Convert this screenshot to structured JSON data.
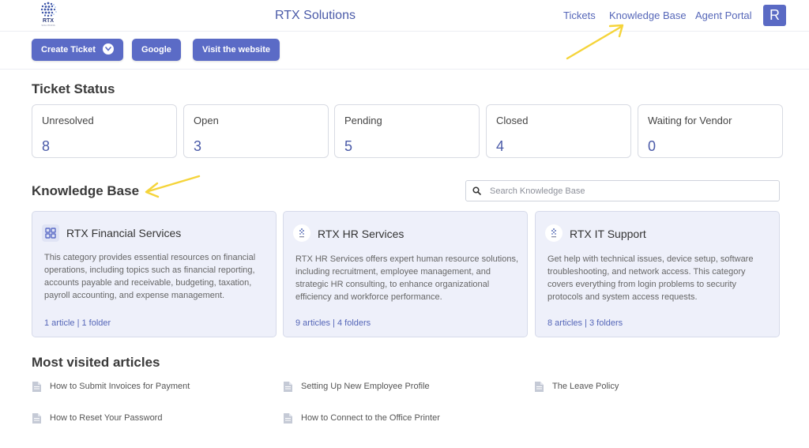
{
  "header": {
    "logo_text": "RTX",
    "logo_subtext": "SOLUTIONS",
    "brand": "RTX Solutions",
    "nav": [
      {
        "label": "Tickets"
      },
      {
        "label": "Knowledge Base"
      },
      {
        "label": "Agent Portal"
      }
    ],
    "avatar_initial": "R"
  },
  "toolbar": {
    "create_ticket": "Create Ticket",
    "google": "Google",
    "visit_website": "Visit the website"
  },
  "ticket_status": {
    "title": "Ticket Status",
    "cards": [
      {
        "label": "Unresolved",
        "value": "8"
      },
      {
        "label": "Open",
        "value": "3"
      },
      {
        "label": "Pending",
        "value": "5"
      },
      {
        "label": "Closed",
        "value": "4"
      },
      {
        "label": "Waiting for Vendor",
        "value": "0"
      }
    ]
  },
  "knowledge_base": {
    "title": "Knowledge Base",
    "search_placeholder": "Search Knowledge Base",
    "categories": [
      {
        "title": "RTX Financial Services",
        "icon": "grid-icon",
        "description": "This category provides essential resources on financial operations, including topics such as financial reporting, accounts payable and receivable, budgeting, taxation, payroll accounting, and expense management.",
        "meta": "1 article  |  1 folder"
      },
      {
        "title": "RTX HR Services",
        "icon": "rtx-logo-icon",
        "description": "RTX HR Services offers expert human resource solutions, including recruitment, employee management, and strategic HR consulting, to enhance organizational efficiency and workforce performance.",
        "meta": "9 articles  |  4 folders"
      },
      {
        "title": "RTX IT Support",
        "icon": "rtx-logo-icon",
        "description": "Get help with technical issues, device setup, software troubleshooting, and network access. This category covers everything from login problems to security protocols and system access requests.",
        "meta": "8 articles  |  3 folders"
      }
    ]
  },
  "most_visited": {
    "title": "Most visited articles",
    "articles": [
      {
        "label": "How to Submit Invoices for Payment"
      },
      {
        "label": "Setting Up New Employee Profile"
      },
      {
        "label": "The Leave Policy"
      },
      {
        "label": "How to Reset Your Password"
      },
      {
        "label": "How to Connect to the Office Printer"
      }
    ]
  },
  "colors": {
    "accent": "#5b6bc6",
    "link": "#5566b8",
    "card_bg": "#eef0fa",
    "annotation_arrow": "#f5d43a"
  }
}
